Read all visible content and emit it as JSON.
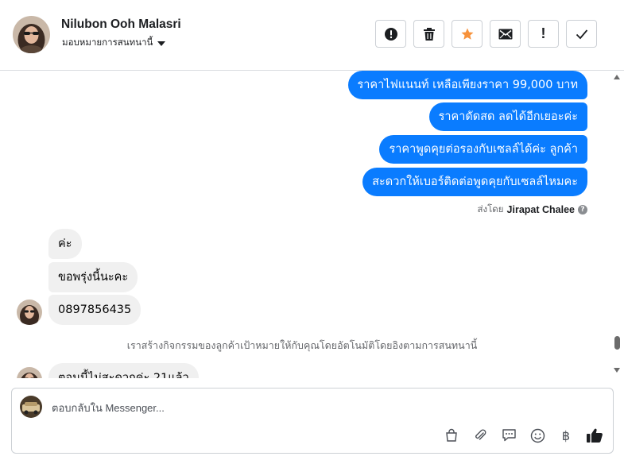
{
  "header": {
    "name": "Nilubon Ooh Malasri",
    "assign_label": "มอบหมายการสนทนานี้"
  },
  "actions": [
    {
      "name": "spam-button",
      "icon": "alert-circle-icon"
    },
    {
      "name": "delete-button",
      "icon": "trash-icon"
    },
    {
      "name": "star-button",
      "icon": "star-icon",
      "color": "#f7923b"
    },
    {
      "name": "mark-unread-button",
      "icon": "envelope-icon"
    },
    {
      "name": "follow-up-button",
      "icon": "exclamation-icon",
      "glyph": "!"
    },
    {
      "name": "done-button",
      "icon": "checkmark-icon"
    }
  ],
  "messages": {
    "outgoing": [
      "ราคาไฟแนนท์  เหลือเพียงราคา 99,000 บาท",
      "ราคาดัดสด ลดได้อีกเยอะค่ะ",
      "ราคาพูดคุยต่อรองกับเซลล์ได้ค่ะ ลูกค้า",
      "สะดวกให้เบอร์ติดต่อพูดคุยกับเซลล์ไหมคะ"
    ],
    "sent_by_prefix": "ส่งโดย",
    "sent_by_name": "Jirapat Chalee",
    "incoming": [
      "ค่ะ",
      "ขอพรุ่งนี้นะคะ",
      "0897856435"
    ],
    "system_note": "เราสร้างกิจกรรมของลูกค้าเป้าหมายให้กับคุณโดยอัตโนมัติโดยอิงตามการสนทนานี้",
    "partial_incoming": "ตอนนี้ไม่สะดวกค่ะ 21แล้ว"
  },
  "composer": {
    "placeholder": "ตอบกลับใน Messenger..."
  },
  "colors": {
    "outgoing_bubble": "#0a7cff",
    "incoming_bubble": "#f0f0f0",
    "star": "#f7923b"
  }
}
